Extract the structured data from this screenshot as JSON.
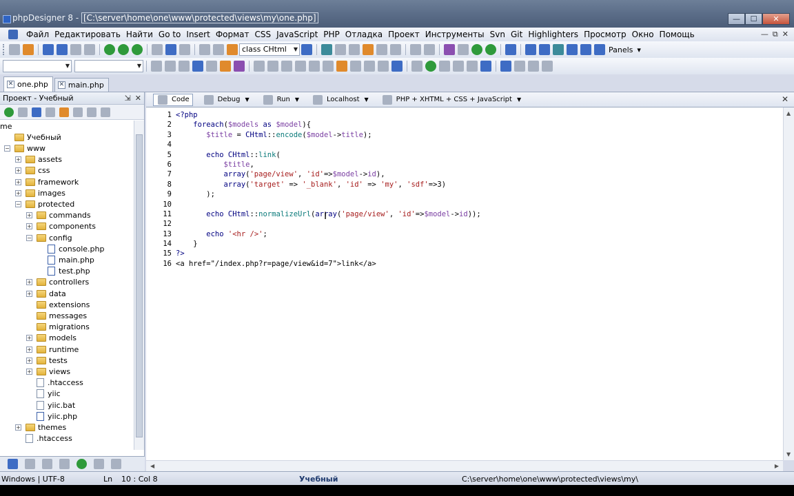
{
  "titlebar": {
    "app_name": "phpDesigner 8 - ",
    "path": "[C:\\server\\home\\one\\www\\protected\\views\\my\\one.php]",
    "controls": {
      "minimize": "—",
      "maximize": "☐",
      "close": "✕"
    }
  },
  "menu": {
    "items": [
      "Файл",
      "Редактировать",
      "Найти",
      "Go to",
      "Insert",
      "Формат",
      "CSS",
      "JavaScript",
      "PHP",
      "Отладка",
      "Проект",
      "Инструменты",
      "Svn",
      "Git",
      "Highlighters",
      "Просмотр",
      "Окно",
      "Помощь"
    ],
    "mdi_controls": [
      "—",
      "⧉",
      "✕"
    ]
  },
  "toolbar": {
    "class_combo": "class CHtml",
    "panels_label": "Panels"
  },
  "doc_tabs": [
    {
      "label": "one.php",
      "active": true
    },
    {
      "label": "main.php",
      "active": false
    }
  ],
  "project_panel": {
    "title": "Проект - Учебный",
    "pin": "⇲",
    "close": "✕",
    "tree": [
      {
        "label": "me",
        "type": "text",
        "level": 0,
        "expander": "none"
      },
      {
        "label": "Учебный",
        "type": "folder",
        "level": 0,
        "expander": "none"
      },
      {
        "label": "www",
        "type": "folder",
        "level": 0,
        "expander": "minus"
      },
      {
        "label": "assets",
        "type": "folder",
        "level": 1,
        "expander": "plus"
      },
      {
        "label": "css",
        "type": "folder",
        "level": 1,
        "expander": "plus"
      },
      {
        "label": "framework",
        "type": "folder",
        "level": 1,
        "expander": "plus"
      },
      {
        "label": "images",
        "type": "folder",
        "level": 1,
        "expander": "plus"
      },
      {
        "label": "protected",
        "type": "folder",
        "level": 1,
        "expander": "minus"
      },
      {
        "label": "commands",
        "type": "folder",
        "level": 2,
        "expander": "plus"
      },
      {
        "label": "components",
        "type": "folder",
        "level": 2,
        "expander": "plus"
      },
      {
        "label": "config",
        "type": "folder",
        "level": 2,
        "expander": "minus"
      },
      {
        "label": "console.php",
        "type": "php",
        "level": 3,
        "expander": "none"
      },
      {
        "label": "main.php",
        "type": "php",
        "level": 3,
        "expander": "none"
      },
      {
        "label": "test.php",
        "type": "php",
        "level": 3,
        "expander": "none"
      },
      {
        "label": "controllers",
        "type": "folder",
        "level": 2,
        "expander": "plus"
      },
      {
        "label": "data",
        "type": "folder",
        "level": 2,
        "expander": "plus"
      },
      {
        "label": "extensions",
        "type": "folder",
        "level": 2,
        "expander": "none"
      },
      {
        "label": "messages",
        "type": "folder",
        "level": 2,
        "expander": "none"
      },
      {
        "label": "migrations",
        "type": "folder",
        "level": 2,
        "expander": "none"
      },
      {
        "label": "models",
        "type": "folder",
        "level": 2,
        "expander": "plus"
      },
      {
        "label": "runtime",
        "type": "folder",
        "level": 2,
        "expander": "plus"
      },
      {
        "label": "tests",
        "type": "folder",
        "level": 2,
        "expander": "plus"
      },
      {
        "label": "views",
        "type": "folder",
        "level": 2,
        "expander": "plus"
      },
      {
        "label": ".htaccess",
        "type": "file",
        "level": 2,
        "expander": "none"
      },
      {
        "label": "yiic",
        "type": "file",
        "level": 2,
        "expander": "none"
      },
      {
        "label": "yiic.bat",
        "type": "file",
        "level": 2,
        "expander": "none"
      },
      {
        "label": "yiic.php",
        "type": "php",
        "level": 2,
        "expander": "none"
      },
      {
        "label": "themes",
        "type": "folder",
        "level": 1,
        "expander": "plus"
      },
      {
        "label": ".htaccess",
        "type": "file",
        "level": 1,
        "expander": "none"
      }
    ]
  },
  "editor_toolbar": {
    "code": "Code",
    "debug": "Debug",
    "run": "Run",
    "localhost": "Localhost",
    "highlighter": "PHP + XHTML + CSS + JavaScript",
    "close": "✕"
  },
  "code_lines": [
    [
      {
        "t": "<?php",
        "c": "kw"
      }
    ],
    [
      {
        "t": "    ",
        "c": "plain"
      },
      {
        "t": "foreach",
        "c": "kw"
      },
      {
        "t": "(",
        "c": "plain"
      },
      {
        "t": "$models",
        "c": "var"
      },
      {
        "t": " as ",
        "c": "kw"
      },
      {
        "t": "$model",
        "c": "var"
      },
      {
        "t": "){",
        "c": "plain"
      }
    ],
    [
      {
        "t": "       ",
        "c": "plain"
      },
      {
        "t": "$title",
        "c": "var"
      },
      {
        "t": " = ",
        "c": "plain"
      },
      {
        "t": "CHtml",
        "c": "kw"
      },
      {
        "t": "::",
        "c": "plain"
      },
      {
        "t": "encode",
        "c": "fn"
      },
      {
        "t": "(",
        "c": "plain"
      },
      {
        "t": "$model",
        "c": "var"
      },
      {
        "t": "->",
        "c": "plain"
      },
      {
        "t": "title",
        "c": "var"
      },
      {
        "t": ");",
        "c": "plain"
      }
    ],
    [],
    [
      {
        "t": "       ",
        "c": "plain"
      },
      {
        "t": "echo",
        "c": "kw"
      },
      {
        "t": " ",
        "c": "plain"
      },
      {
        "t": "CHtml",
        "c": "kw"
      },
      {
        "t": "::",
        "c": "plain"
      },
      {
        "t": "link",
        "c": "fn"
      },
      {
        "t": "(",
        "c": "plain"
      }
    ],
    [
      {
        "t": "           ",
        "c": "plain"
      },
      {
        "t": "$title",
        "c": "var"
      },
      {
        "t": ",",
        "c": "plain"
      }
    ],
    [
      {
        "t": "           ",
        "c": "plain"
      },
      {
        "t": "array",
        "c": "kw"
      },
      {
        "t": "(",
        "c": "plain"
      },
      {
        "t": "'page/view'",
        "c": "str"
      },
      {
        "t": ", ",
        "c": "plain"
      },
      {
        "t": "'id'",
        "c": "str"
      },
      {
        "t": "=>",
        "c": "plain"
      },
      {
        "t": "$model",
        "c": "var"
      },
      {
        "t": "->",
        "c": "plain"
      },
      {
        "t": "id",
        "c": "var"
      },
      {
        "t": "),",
        "c": "plain"
      }
    ],
    [
      {
        "t": "           ",
        "c": "plain"
      },
      {
        "t": "array",
        "c": "kw"
      },
      {
        "t": "(",
        "c": "plain"
      },
      {
        "t": "'target'",
        "c": "str"
      },
      {
        "t": " => ",
        "c": "plain"
      },
      {
        "t": "'_blank'",
        "c": "str"
      },
      {
        "t": ", ",
        "c": "plain"
      },
      {
        "t": "'id'",
        "c": "str"
      },
      {
        "t": " => ",
        "c": "plain"
      },
      {
        "t": "'my'",
        "c": "str"
      },
      {
        "t": ", ",
        "c": "plain"
      },
      {
        "t": "'sdf'",
        "c": "str"
      },
      {
        "t": "=>3)",
        "c": "plain"
      }
    ],
    [
      {
        "t": "       ",
        "c": "plain"
      },
      {
        "t": ");",
        "c": "plain"
      }
    ],
    [],
    [
      {
        "t": "       ",
        "c": "plain"
      },
      {
        "t": "echo",
        "c": "kw"
      },
      {
        "t": " ",
        "c": "plain"
      },
      {
        "t": "CHtml",
        "c": "kw"
      },
      {
        "t": "::",
        "c": "plain"
      },
      {
        "t": "normalizeUrl",
        "c": "fn"
      },
      {
        "t": "(",
        "c": "plain"
      },
      {
        "t": "array",
        "c": "kw"
      },
      {
        "t": "(",
        "c": "plain"
      },
      {
        "t": "'page/view'",
        "c": "str"
      },
      {
        "t": ", ",
        "c": "plain"
      },
      {
        "t": "'id'",
        "c": "str"
      },
      {
        "t": "=>",
        "c": "plain"
      },
      {
        "t": "$model",
        "c": "var"
      },
      {
        "t": "->",
        "c": "plain"
      },
      {
        "t": "id",
        "c": "var"
      },
      {
        "t": "));",
        "c": "plain"
      }
    ],
    [],
    [
      {
        "t": "       ",
        "c": "plain"
      },
      {
        "t": "echo",
        "c": "kw"
      },
      {
        "t": " ",
        "c": "plain"
      },
      {
        "t": "'<hr />'",
        "c": "str"
      },
      {
        "t": ";",
        "c": "plain"
      }
    ],
    [
      {
        "t": "    ",
        "c": "plain"
      },
      {
        "t": "}",
        "c": "plain"
      }
    ],
    [
      {
        "t": "?>",
        "c": "kw"
      }
    ],
    [
      {
        "t": "<a href=\"/index.php?r=page/view&id=7\">link</a>",
        "c": "html"
      }
    ]
  ],
  "statusbar": {
    "eol": "Windows | UTF-8",
    "ln_label": "Ln",
    "position": "10 : Col   8",
    "project": "Учебный",
    "path": "C:\\server\\home\\one\\www\\protected\\views\\my\\"
  }
}
